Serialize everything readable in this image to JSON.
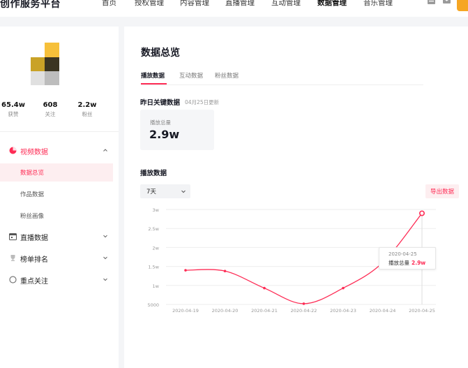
{
  "app": {
    "title": "创作服务平台"
  },
  "nav": {
    "items": [
      {
        "label": "首页",
        "active": false
      },
      {
        "label": "授权管理",
        "active": false
      },
      {
        "label": "内容管理",
        "active": false
      },
      {
        "label": "直播管理",
        "active": false
      },
      {
        "label": "互动管理",
        "active": false
      },
      {
        "label": "数据管理",
        "active": true
      },
      {
        "label": "音乐管理",
        "active": false
      }
    ],
    "icons": [
      "document-icon",
      "mail-icon",
      "user-avatar"
    ]
  },
  "profile": {
    "stats": [
      {
        "value": "65.4w",
        "label": "获赞"
      },
      {
        "value": "608",
        "label": "关注"
      },
      {
        "value": "2.2w",
        "label": "粉丝"
      }
    ]
  },
  "sidebar": {
    "groups": [
      {
        "label": "视频数据",
        "icon": "pie-chart-icon",
        "open": true,
        "items": [
          {
            "label": "数据总览",
            "active": true
          },
          {
            "label": "作品数据",
            "active": false
          },
          {
            "label": "粉丝画像",
            "active": false
          }
        ]
      },
      {
        "label": "直播数据",
        "icon": "calendar-icon",
        "open": false,
        "items": []
      },
      {
        "label": "榜单排名",
        "icon": "trophy-icon",
        "open": false,
        "items": []
      },
      {
        "label": "重点关注",
        "icon": "circle-icon",
        "open": false,
        "items": []
      }
    ]
  },
  "main": {
    "title": "数据总览",
    "tabs": [
      {
        "label": "播放数据",
        "active": true
      },
      {
        "label": "互动数据",
        "active": false
      },
      {
        "label": "粉丝数据",
        "active": false
      }
    ],
    "yesterday": {
      "title": "昨日关键数据",
      "updated": "04月25日更新",
      "kpi_label": "播放总量",
      "kpi_value": "2.9w"
    },
    "play_section": {
      "title": "播放数据",
      "range": "7天",
      "export_label": "导出数据"
    },
    "tooltip": {
      "date": "2020-04-25",
      "label": "播放总量",
      "value": "2.9w"
    }
  },
  "colors": {
    "accent": "#fe2c55",
    "brand_yellow": "#f6c03a"
  },
  "chart_data": {
    "type": "line",
    "x": [
      "2020-04-19",
      "2020-04-20",
      "2020-04-21",
      "2020-04-22",
      "2020-04-23",
      "2020-04-24",
      "2020-04-25"
    ],
    "series": [
      {
        "values": [
          14000,
          13800,
          9300,
          5200,
          9300,
          16000,
          29000
        ]
      }
    ],
    "ytick_labels": [
      "5000",
      "1w",
      "1.5w",
      "2w",
      "2.5w",
      "3w"
    ],
    "yticks": [
      5000,
      10000,
      15000,
      20000,
      25000,
      30000
    ],
    "ylim": [
      5000,
      30000
    ],
    "grid": true,
    "highlight_index": 6
  }
}
